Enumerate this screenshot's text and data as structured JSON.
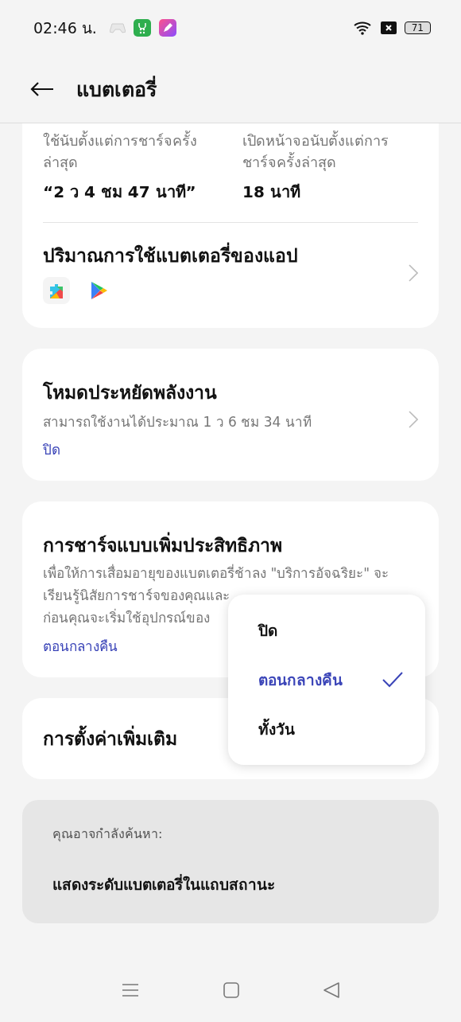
{
  "status_bar": {
    "time": "02:46 น.",
    "battery": "71"
  },
  "header": {
    "title": "แบตเตอรี่"
  },
  "usage": {
    "items": [
      {
        "label": "ใช้นับตั้งแต่การชาร์จครั้งล่าสุด",
        "value": "“2 ว 4 ชม 47 นาที”"
      },
      {
        "label": "เปิดหน้าจอนับตั้งแต่การชาร์จครั้งล่าสุด",
        "value": "18 นาที"
      }
    ]
  },
  "app_usage": {
    "title": "ปริมาณการใช้แบตเตอรี่ของแอป"
  },
  "power_saving": {
    "title": "โหมดประหยัดพลังงาน",
    "subtitle": "สามารถใช้งานได้ประมาณ 1 ว 6 ชม 34 นาที",
    "value": "ปิด"
  },
  "optimized_charging": {
    "title": "การชาร์จแบบเพิ่มประสิทธิภาพ",
    "description": "เพื่อให้การเสื่อมอายุของแบตเตอรี่ช้าลง \"บริการอัจฉริยะ\" จะ\nเรียนรู้นิสัยการชาร์จของคุณและ\nก่อนคุณจะเริ่มใช้อุปกรณ์ของ",
    "value": "ตอนกลางคืน"
  },
  "more_settings": {
    "title": "การตั้งค่าเพิ่มเติม"
  },
  "suggestions": {
    "heading": "คุณอาจกำลังค้นหา:",
    "items": [
      "แสดงระดับแบตเตอรี่ในแถบสถานะ"
    ]
  },
  "dropdown": {
    "options": [
      {
        "label": "ปิด",
        "selected": false
      },
      {
        "label": "ตอนกลางคืน",
        "selected": true
      },
      {
        "label": "ทั้งวัน",
        "selected": false
      }
    ]
  }
}
